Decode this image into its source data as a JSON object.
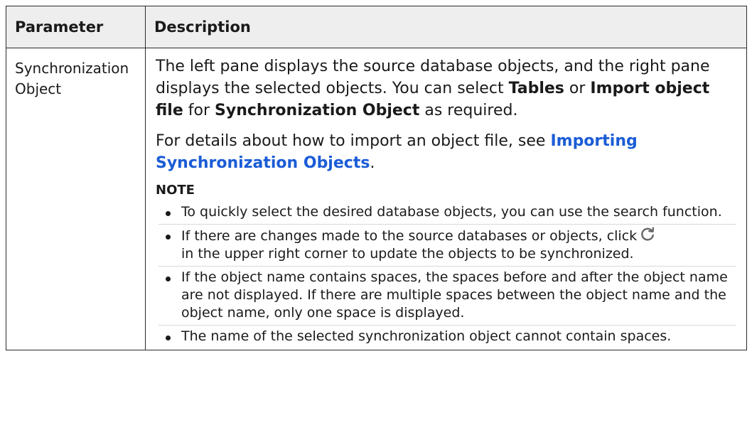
{
  "table": {
    "headers": {
      "parameter": "Parameter",
      "description": "Description"
    },
    "row": {
      "parameter": "Synchronization Object",
      "para1": {
        "t1": "The left pane displays the source database objects, and the right pane displays the selected objects. You can select ",
        "b1": "Tables",
        "t2": " or ",
        "b2": "Import object file",
        "t3": " for ",
        "b3": "Synchronization Object",
        "t4": " as required."
      },
      "para2": {
        "t1": "For details about how to import an object file, see ",
        "link": "Importing Synchronization Objects",
        "t2": "."
      },
      "note": {
        "title": "NOTE",
        "items": [
          {
            "text": "To quickly select the desired database objects, you can use the search function."
          },
          {
            "text_before": "If there are changes made to the source databases or objects, click",
            "text_after": " in the upper right corner to update the objects to be synchronized.",
            "icon": "refresh-icon"
          },
          {
            "text": "If the object name contains spaces, the spaces before and after the object name are not displayed. If there are multiple spaces between the object name and the object name, only one space is displayed."
          },
          {
            "text": "The name of the selected synchronization object cannot contain spaces."
          }
        ]
      }
    }
  }
}
